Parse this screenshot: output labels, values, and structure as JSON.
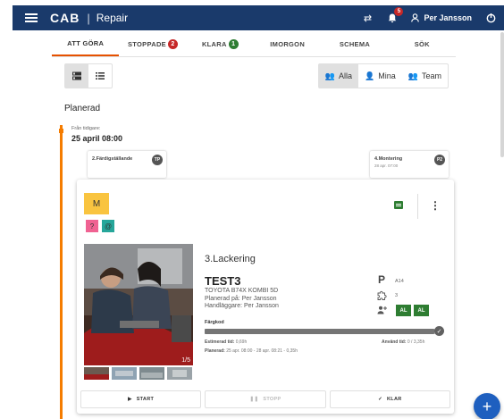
{
  "header": {
    "logo": "CAB",
    "app_name": "Repair",
    "notifications_count": "5",
    "user_name": "Per Jansson"
  },
  "tabs": [
    {
      "label": "ATT GÖRA",
      "active": true
    },
    {
      "label": "STOPPADE",
      "badge": "2",
      "badge_color": "#c62828"
    },
    {
      "label": "KLARA",
      "badge": "1",
      "badge_color": "#2e7d32"
    },
    {
      "label": "IMORGON"
    },
    {
      "label": "SCHEMA"
    },
    {
      "label": "SÖK"
    }
  ],
  "filters": {
    "all": "Alla",
    "mine": "Mina",
    "team": "Team"
  },
  "section": {
    "title": "Planerad",
    "from_label": "Från tidigare:",
    "from_date": "25 april 08:00"
  },
  "mini_cards": [
    {
      "title": "2.Färdigställande",
      "subtitle": "",
      "chip": "TP"
    },
    {
      "title": "4.Montering",
      "subtitle": "28 apr. 07:00",
      "chip": "P2"
    }
  ],
  "card": {
    "category": "M",
    "flags": [
      "?",
      "@"
    ],
    "photo_count": "1/5",
    "operation": "3.Lackering",
    "order_title": "TEST3",
    "vehicle": "TOYOTA B74X KOMBI 5D",
    "planned_on": "Planerad på: Per Jansson",
    "handler": "Handläggare: Per Jansson",
    "parking_label": "P",
    "parking_value": "A14",
    "parts_value": "3",
    "workers": [
      "AL",
      "AL"
    ],
    "step_label": "Färgkod",
    "progress": 0.98,
    "estimated_label": "Estimerad tid:",
    "estimated_value": "0,69h",
    "used_label": "Använd tid:",
    "used_value": "0 / 3,35h",
    "planned_label": "Planerad:",
    "planned_value": "25 apr. 08:00 - 28 apr. 08:21 - 0,35h",
    "actions": {
      "start": "START",
      "stop": "STOPP",
      "done": "KLAR"
    }
  },
  "colors": {
    "topbar": "#1a3a6b",
    "accent": "#f57c00",
    "fab": "#1e5fbf",
    "category": "#f9c440"
  }
}
